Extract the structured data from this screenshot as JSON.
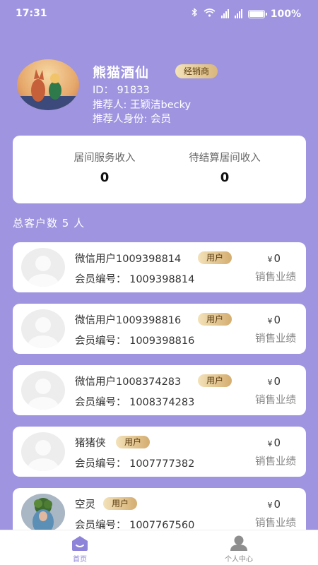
{
  "status_bar": {
    "time": "17:31",
    "battery": "100%"
  },
  "profile": {
    "name": "熊猫酒仙",
    "badge": "经销商",
    "id_line": "ID：  91833",
    "referrer_line": "推荐人: 王颖洁becky",
    "referrer_role_line": "推荐人身份: 会员"
  },
  "income": {
    "service_label": "居间服务收入",
    "service_value": "0",
    "pending_label": "待结算居间收入",
    "pending_value": "0"
  },
  "summary": {
    "total_customers": "总客户数 5 人"
  },
  "customers": [
    {
      "name": "微信用户1009398814",
      "badge": "用户",
      "member_no": "会员编号：  1009398814",
      "currency": "¥",
      "amount": "0",
      "sales_label": "销售业绩"
    },
    {
      "name": "微信用户1009398816",
      "badge": "用户",
      "member_no": "会员编号：  1009398816",
      "currency": "¥",
      "amount": "0",
      "sales_label": "销售业绩"
    },
    {
      "name": "微信用户1008374283",
      "badge": "用户",
      "member_no": "会员编号：  1008374283",
      "currency": "¥",
      "amount": "0",
      "sales_label": "销售业绩"
    },
    {
      "name": "猪猪侠",
      "badge": "用户",
      "member_no": "会员编号：  1007777382",
      "currency": "¥",
      "amount": "0",
      "sales_label": "销售业绩"
    },
    {
      "name": "空灵",
      "badge": "用户",
      "member_no": "会员编号：  1007767560",
      "currency": "¥",
      "amount": "0",
      "sales_label": "销售业绩"
    }
  ],
  "tabbar": {
    "home": "首页",
    "me": "个人中心"
  },
  "colors": {
    "background": "#9e94e0",
    "accent": "#8d83d8",
    "badge_gold": "#d9b77d"
  }
}
